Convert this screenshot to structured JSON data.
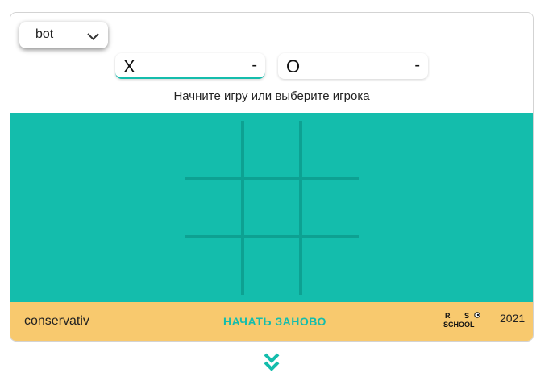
{
  "header": {
    "mode": {
      "label": "bot",
      "icon": "chevron-down-icon"
    },
    "players": [
      {
        "symbol": "X",
        "score": "-",
        "active": true
      },
      {
        "symbol": "O",
        "score": "-",
        "active": false
      }
    ],
    "status": "Начните игру или выберите игрока"
  },
  "board": {
    "cells": [
      "",
      "",
      "",
      "",
      "",
      "",
      "",
      "",
      ""
    ],
    "background_color": "#14bdac",
    "line_color": "#0da192"
  },
  "footer": {
    "ai_name": "conservativ",
    "restart_label": "НАЧАТЬ ЗАНОВО",
    "logo": "RS School logo",
    "year": "2021",
    "background_color": "#f8c96e"
  },
  "scroll": {
    "icon": "double-chevron-down-icon",
    "color": "#14bdac"
  }
}
